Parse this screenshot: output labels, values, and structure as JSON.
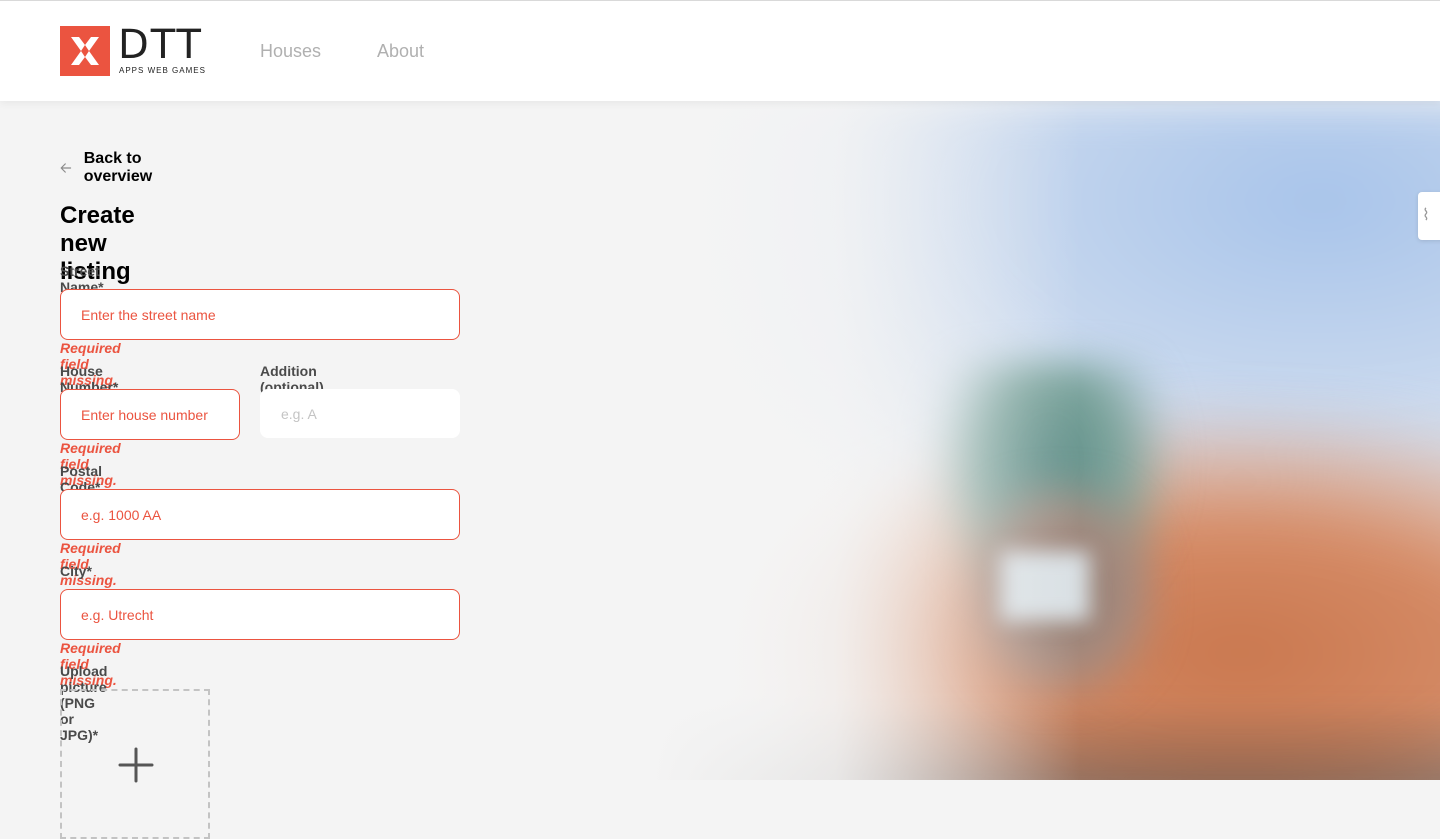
{
  "header": {
    "logo_text": "DTT",
    "logo_subtitle": "APPS WEB GAMES",
    "nav": [
      {
        "label": "Houses"
      },
      {
        "label": "About"
      }
    ]
  },
  "back_link": {
    "label": "Back to overview",
    "icon": "arrow-left-icon"
  },
  "page_title": "Create new listing",
  "form": {
    "street_name": {
      "label": "Street Name*",
      "placeholder": "Enter the street name",
      "error": "Required field missing."
    },
    "house_number": {
      "label": "House Number*",
      "placeholder": "Enter house number",
      "error": "Required field missing."
    },
    "addition": {
      "label": "Addition (optional)",
      "placeholder": "e.g. A"
    },
    "postal_code": {
      "label": "Postal Code*",
      "placeholder": "e.g. 1000 AA",
      "error": "Required field missing."
    },
    "city": {
      "label": "City*",
      "placeholder": "e.g. Utrecht",
      "error": "Required field missing."
    },
    "upload": {
      "label": "Upload picture (PNG or JPG)*",
      "icon": "plus-icon"
    }
  },
  "colors": {
    "accent": "#eb5440",
    "text_primary": "#000000",
    "text_secondary": "#4a4a4a",
    "nav_inactive": "#b0b0b0",
    "background": "#f4f4f4"
  }
}
